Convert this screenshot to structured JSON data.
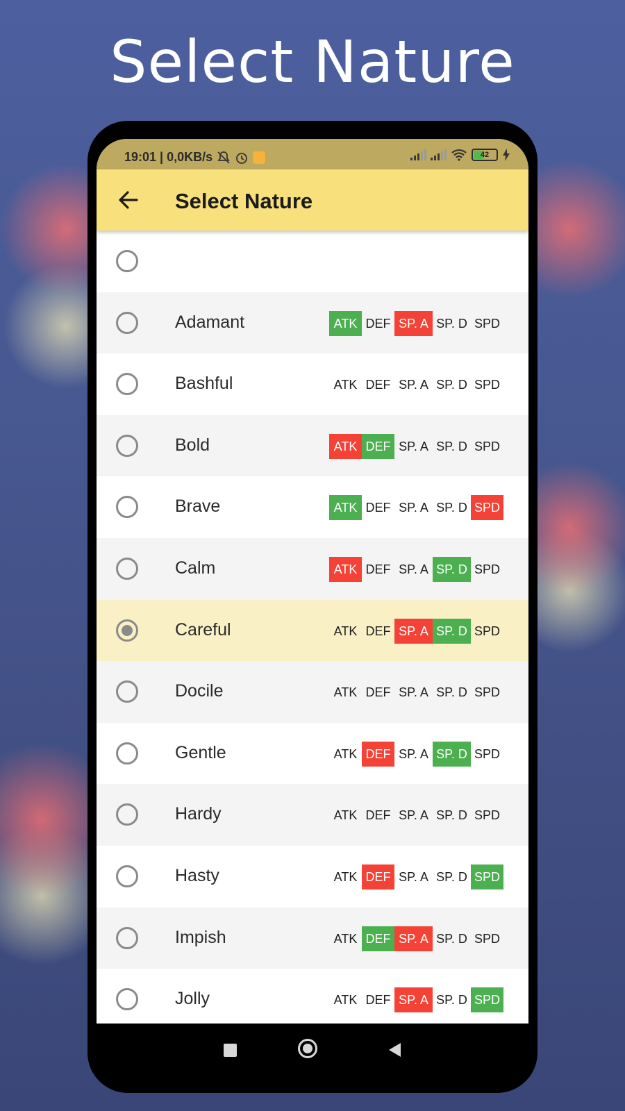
{
  "headline": "Select Nature",
  "status": {
    "left_text": "19:01 | 0,0KB/s",
    "battery": "42"
  },
  "appbar": {
    "title": "Select Nature"
  },
  "stat_labels": [
    "ATK",
    "DEF",
    "SP. A",
    "SP. D",
    "SPD"
  ],
  "natures": [
    {
      "name": "",
      "stats": [
        "",
        "",
        "",
        "",
        ""
      ],
      "selected": false,
      "blank": true
    },
    {
      "name": "Adamant",
      "stats": [
        "up",
        "",
        "down",
        "",
        ""
      ],
      "selected": false
    },
    {
      "name": "Bashful",
      "stats": [
        "",
        "",
        "",
        "",
        ""
      ],
      "selected": false
    },
    {
      "name": "Bold",
      "stats": [
        "down",
        "up",
        "",
        "",
        ""
      ],
      "selected": false
    },
    {
      "name": "Brave",
      "stats": [
        "up",
        "",
        "",
        "",
        "down"
      ],
      "selected": false
    },
    {
      "name": "Calm",
      "stats": [
        "down",
        "",
        "",
        "up",
        ""
      ],
      "selected": false
    },
    {
      "name": "Careful",
      "stats": [
        "",
        "",
        "down",
        "up",
        ""
      ],
      "selected": true
    },
    {
      "name": "Docile",
      "stats": [
        "",
        "",
        "",
        "",
        ""
      ],
      "selected": false
    },
    {
      "name": "Gentle",
      "stats": [
        "",
        "down",
        "",
        "up",
        ""
      ],
      "selected": false
    },
    {
      "name": "Hardy",
      "stats": [
        "",
        "",
        "",
        "",
        ""
      ],
      "selected": false
    },
    {
      "name": "Hasty",
      "stats": [
        "",
        "down",
        "",
        "",
        "up"
      ],
      "selected": false
    },
    {
      "name": "Impish",
      "stats": [
        "",
        "up",
        "down",
        "",
        ""
      ],
      "selected": false
    },
    {
      "name": "Jolly",
      "stats": [
        "",
        "",
        "down",
        "",
        "up"
      ],
      "selected": false
    }
  ],
  "colors": {
    "increase": "#4caf50",
    "decrease": "#f44336",
    "appbar": "#f8e07c",
    "selected_row": "#f9f0c6"
  },
  "icons": [
    "back-arrow-icon",
    "mute-icon",
    "alarm-icon",
    "notification-icon",
    "signal-icon",
    "wifi-icon",
    "battery-icon",
    "charging-icon",
    "recent-apps-icon",
    "home-icon",
    "nav-back-icon"
  ]
}
